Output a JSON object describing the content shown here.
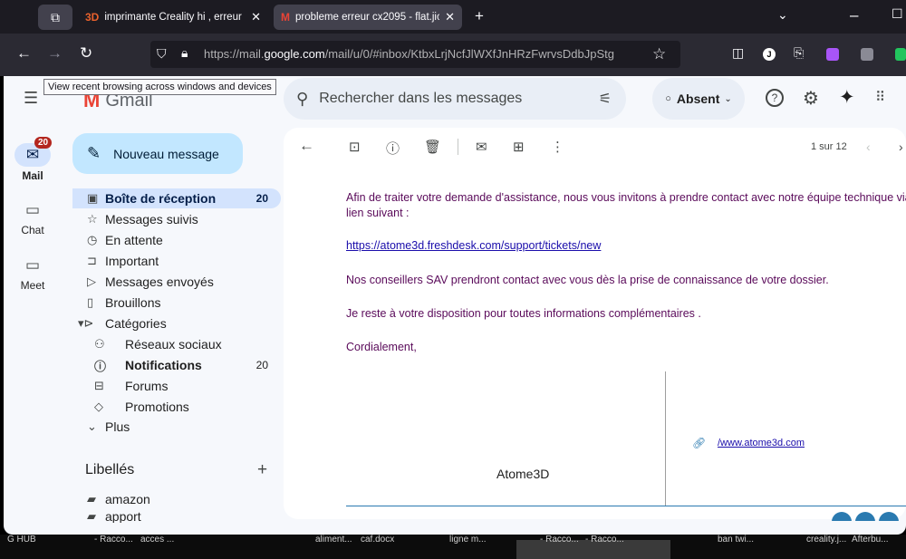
{
  "browser": {
    "tabs": [
      {
        "favicon": "3D",
        "title": "imprimante Creality hi , erreur : c",
        "active": false
      },
      {
        "favicon": "gmail-icon",
        "title": "probleme erreur cx2095 - flat.jic",
        "active": true
      }
    ],
    "url_prefix": "https://mail.",
    "url_domain": "google.com",
    "url_path": "/mail/u/0/#inbox/KtbxLrjNcfJlWXfJnHRzFwrvsDdbJpStg",
    "tooltip": "View recent browsing across windows and devices"
  },
  "gmail": {
    "logo_text": "Gmail",
    "search_placeholder": "Rechercher dans les messages",
    "status": "Absent",
    "rail": {
      "mail": {
        "label": "Mail",
        "badge": "20"
      },
      "chat": {
        "label": "Chat"
      },
      "meet": {
        "label": "Meet"
      }
    },
    "compose_label": "Nouveau message",
    "nav": [
      {
        "label": "Boîte de réception",
        "count": "20"
      },
      {
        "label": "Messages suivis",
        "count": ""
      },
      {
        "label": "En attente",
        "count": ""
      },
      {
        "label": "Important",
        "count": ""
      },
      {
        "label": "Messages envoyés",
        "count": ""
      },
      {
        "label": "Brouillons",
        "count": ""
      },
      {
        "label": "Catégories",
        "count": ""
      }
    ],
    "categories": [
      {
        "label": "Réseaux sociaux",
        "count": ""
      },
      {
        "label": "Notifications",
        "count": "20"
      },
      {
        "label": "Forums",
        "count": ""
      },
      {
        "label": "Promotions",
        "count": ""
      }
    ],
    "more_label": "Plus",
    "labels_heading": "Libellés",
    "labels": [
      {
        "label": "amazon"
      },
      {
        "label": "apport"
      }
    ],
    "pager": "1 sur 12",
    "message": {
      "line1": "Afin de traiter votre demande d'assistance, nous vous invitons à prendre contact avec notre équipe technique via",
      "line2": "lien suivant :",
      "link": "https://atome3d.freshdesk.com/support/tickets/new",
      "line3": "Nos conseillers SAV prendront contact avec vous dès la prise de connaissance de votre dossier.",
      "line4": "Je reste à votre disposition pour toutes informations  complémentaires .",
      "line5": "Cordialement,",
      "sig_name": "Atome3D",
      "sig_link": "/www.atome3d.com"
    }
  },
  "taskbar": [
    "G HUB",
    "- Racco...",
    "acces ...",
    "aliment...",
    "caf.docx",
    "ligne m...",
    "- Racco...",
    "- Racco...",
    "ban twi...",
    "creality.j...",
    "Afterbu..."
  ]
}
